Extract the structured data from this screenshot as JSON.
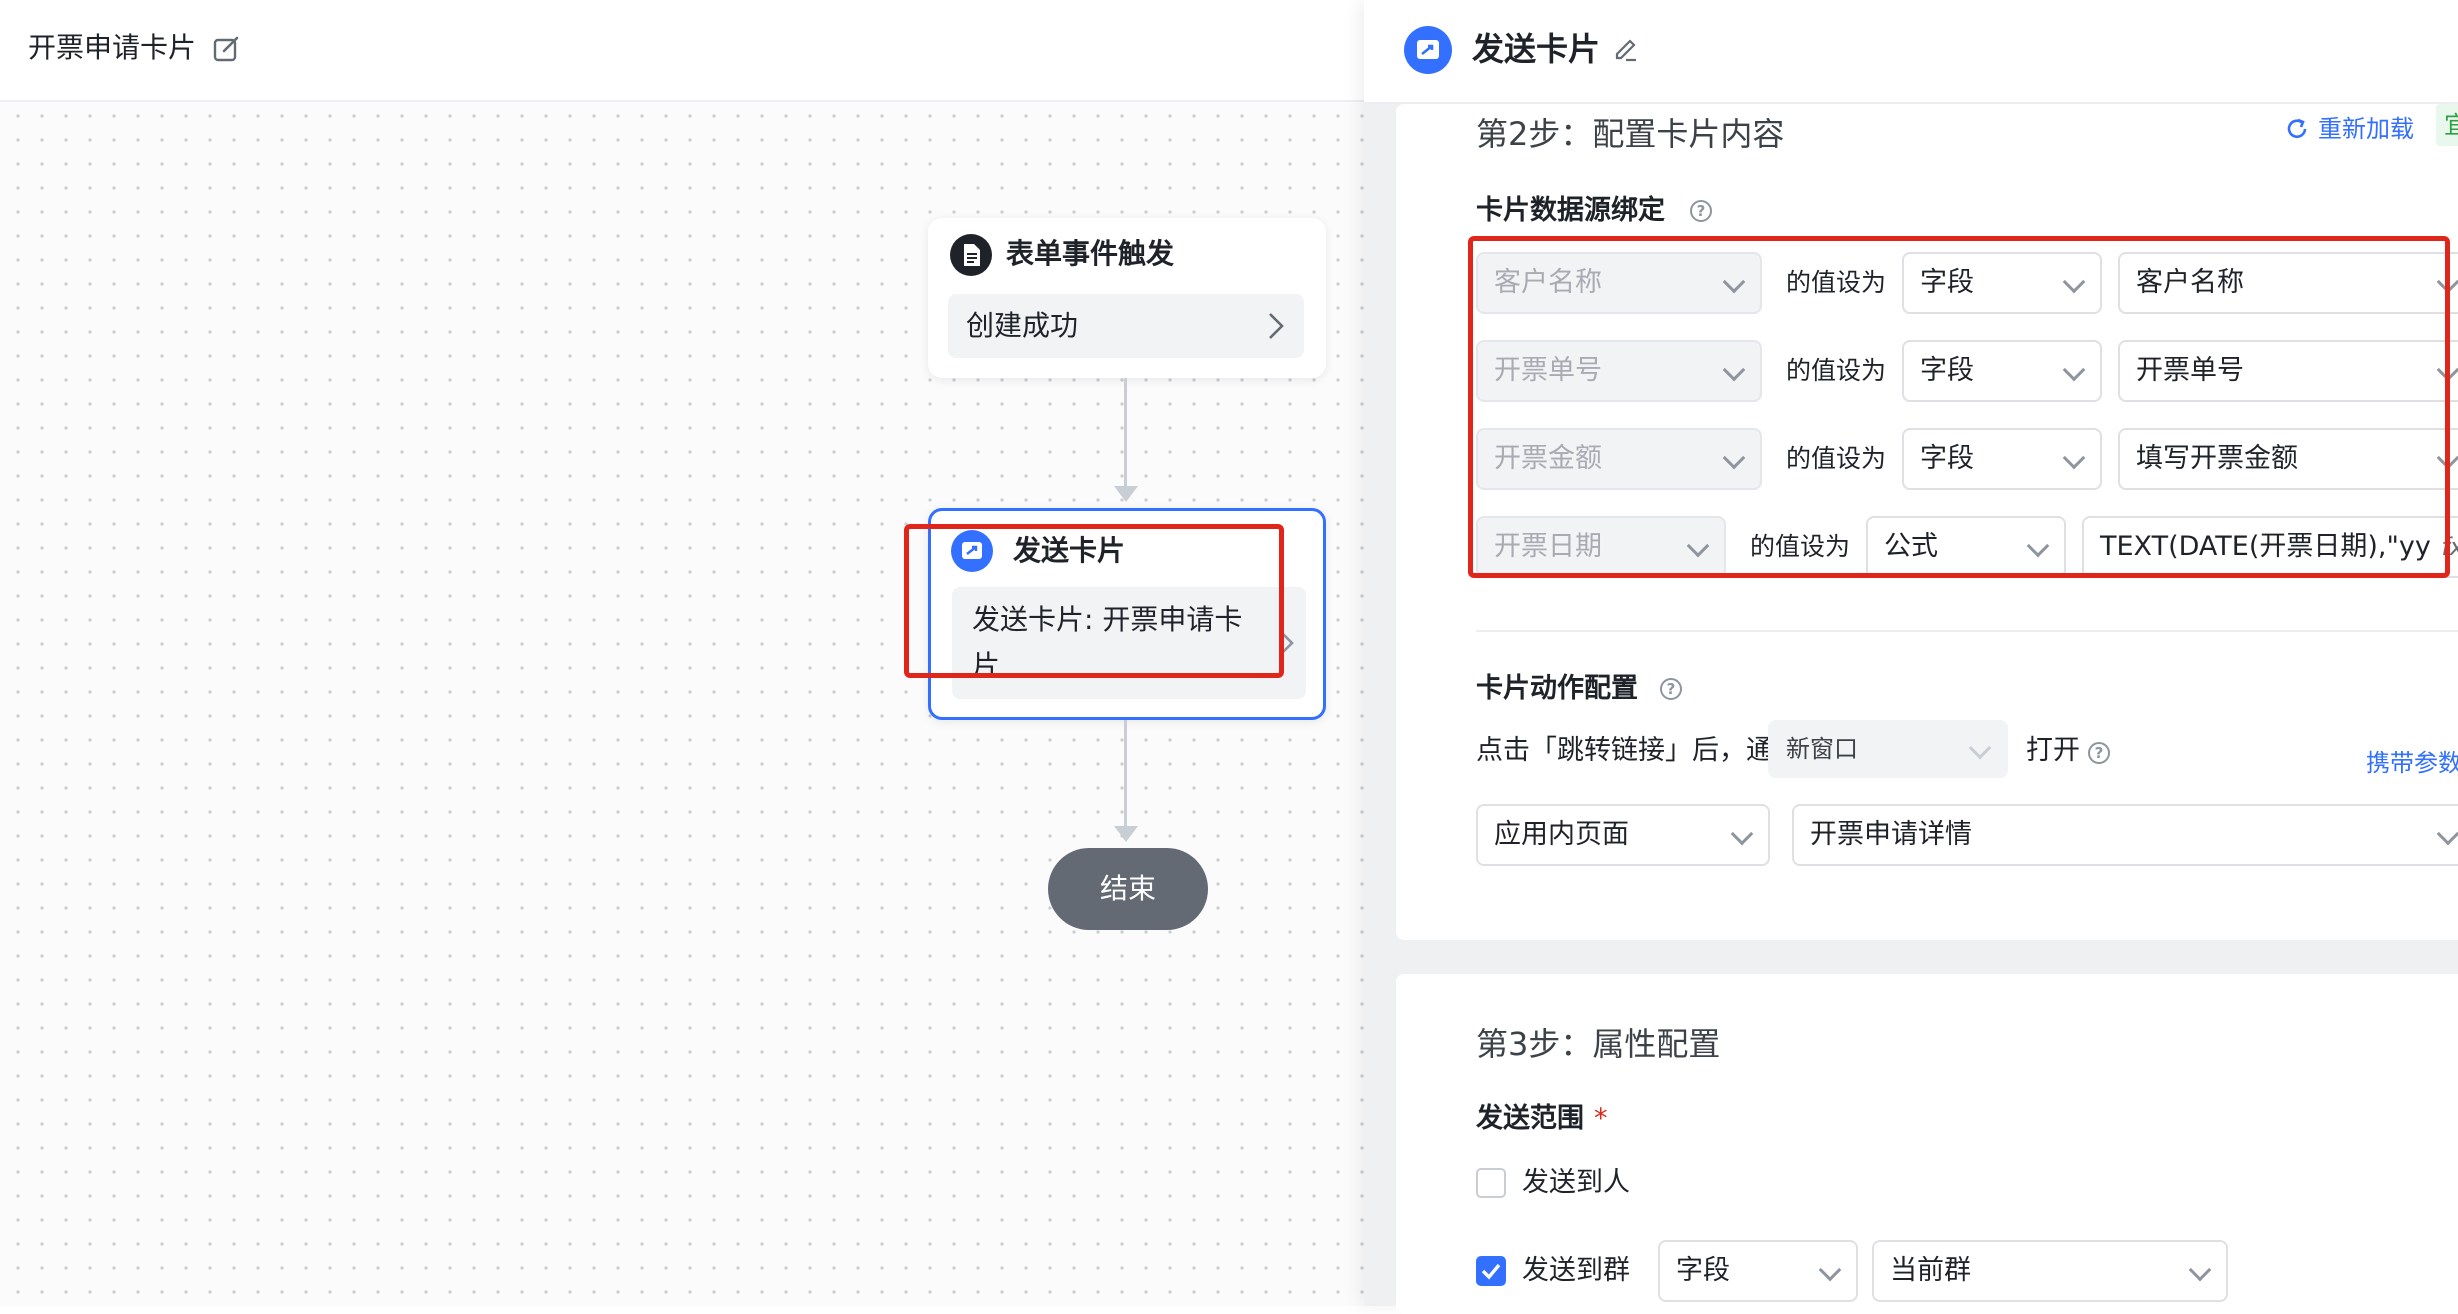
{
  "flow": {
    "title": "开票申请卡片"
  },
  "nodes": {
    "trigger": {
      "title": "表单事件触发",
      "body": "创建成功"
    },
    "send_card": {
      "title": "发送卡片",
      "body_line1": "发送卡片: 开票申请卡",
      "body_line2": "片"
    },
    "end": {
      "label": "结束"
    }
  },
  "panel": {
    "title": "发送卡片",
    "step2": {
      "title": "第2步：配置卡片内容",
      "reload_label": "重新加载",
      "cut_tag": "宜",
      "binding_title": "卡片数据源绑定",
      "bindings": [
        {
          "target": "客户名称",
          "connector": "的值设为",
          "type": "字段",
          "value": "客户名称"
        },
        {
          "target": "开票单号",
          "connector": "的值设为",
          "type": "字段",
          "value": "开票单号"
        },
        {
          "target": "开票金额",
          "connector": "的值设为",
          "type": "字段",
          "value": "填写开票金额"
        },
        {
          "target": "开票日期",
          "connector": "的值设为",
          "type": "公式",
          "value": "TEXT(DATE(开票日期),\"yy",
          "fx": "fx"
        }
      ],
      "action_title": "卡片动作配置",
      "action_prefix": "点击「跳转链接」后，通过",
      "window_option": "新窗口",
      "action_suffix": "打开",
      "carry_params": "携带参数",
      "page_type": "应用内页面",
      "page_value": "开票申请详情"
    },
    "step3": {
      "title": "第3步：属性配置",
      "scope_title": "发送范围",
      "required_mark": "*",
      "send_to_person": "发送到人",
      "send_to_group": "发送到群",
      "group_type": "字段",
      "group_value": "当前群"
    },
    "help_glyph": "?"
  },
  "colors": {
    "accent": "#3370ff",
    "highlight": "#e0261b",
    "end_node": "#646a73",
    "trigger_icon": "#1f2329"
  },
  "icons": {
    "flow_edit": "edit-square-icon",
    "trigger": "document-icon",
    "send_card": "card-send-icon",
    "reload": "refresh-icon",
    "panel_edit": "pencil-icon",
    "dropdown": "chevron-down-icon",
    "node_arrow": "chevron-right-icon"
  }
}
